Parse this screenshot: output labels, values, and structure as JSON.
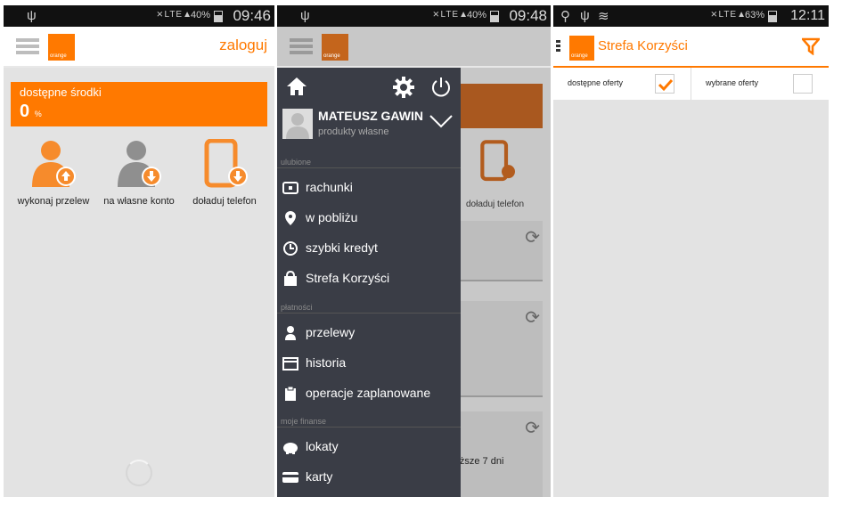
{
  "screens": [
    {
      "status": {
        "battery": "40%",
        "time": "09:46"
      },
      "header": {
        "logo_text": "orange",
        "login": "zaloguj"
      },
      "funds": {
        "label": "dostępne środki",
        "value": "0",
        "unit": "%"
      },
      "actions": [
        {
          "label": "wykonaj przelew",
          "icon": "person-upload-icon"
        },
        {
          "label": "na własne konto",
          "icon": "person-download-icon"
        },
        {
          "label": "doładuj telefon",
          "icon": "phone-topup-icon"
        }
      ]
    },
    {
      "status": {
        "battery": "40%",
        "time": "09:48"
      },
      "header": {
        "logo_text": "orange"
      },
      "background": {
        "phone_caption": "doładuj telefon",
        "card_text": "liższe 7 dni"
      },
      "drawer": {
        "user_name": "MATEUSZ GAWIN",
        "user_sub": "produkty własne",
        "sections": [
          {
            "title": "ulubione",
            "items": [
              {
                "label": "rachunki",
                "icon": "wallet-icon"
              },
              {
                "label": "w pobliżu",
                "icon": "location-pin-icon"
              },
              {
                "label": "szybki kredyt",
                "icon": "clock-icon"
              },
              {
                "label": "Strefa Korzyści",
                "icon": "shopping-bag-icon"
              }
            ]
          },
          {
            "title": "płatności",
            "items": [
              {
                "label": "przelewy",
                "icon": "person-icon"
              },
              {
                "label": "historia",
                "icon": "calendar-icon"
              },
              {
                "label": "operacje zaplanowane",
                "icon": "clipboard-icon"
              }
            ]
          },
          {
            "title": "moje finanse",
            "items": [
              {
                "label": "lokaty",
                "icon": "piggy-bank-icon"
              },
              {
                "label": "karty",
                "icon": "credit-card-icon"
              }
            ]
          }
        ]
      }
    },
    {
      "status": {
        "battery": "63%",
        "time": "12:11"
      },
      "header": {
        "logo_text": "orange",
        "title": "Strefa Korzyści"
      },
      "filters": [
        {
          "label": "dostępne oferty",
          "checked": true
        },
        {
          "label": "wybrane oferty",
          "checked": false
        }
      ]
    }
  ],
  "colors": {
    "accent": "#ff7900",
    "drawer": "#3a3d46",
    "background": "#e3e3e3"
  }
}
